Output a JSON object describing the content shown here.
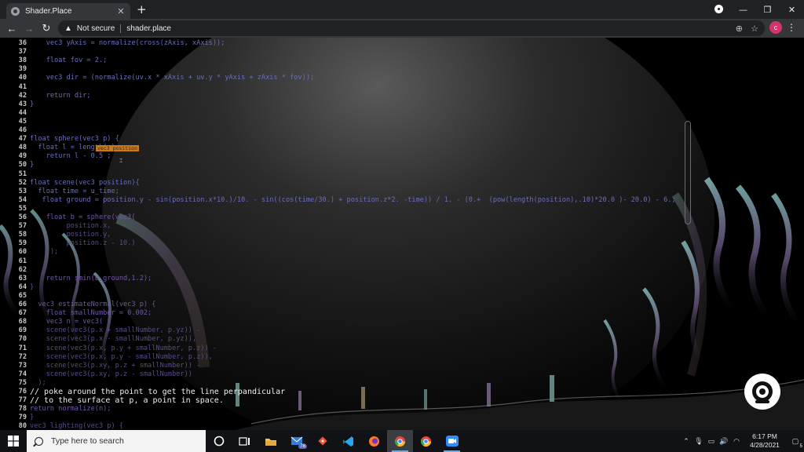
{
  "browser": {
    "tab_title": "Shader.Place",
    "tab_close": "✕",
    "new_tab": "+",
    "security_text": "Not secure",
    "url": "shader.place",
    "profile_initial": "c"
  },
  "window_controls": {
    "minimize": "—",
    "restore": "❐",
    "close": "✕"
  },
  "editor": {
    "tooltip": "vec3 position",
    "lines": [
      {
        "n": "36",
        "code": "    vec3 yAxis = normalize(cross(zAxis, xAxis));",
        "style": "normal"
      },
      {
        "n": "37",
        "code": "",
        "style": "normal"
      },
      {
        "n": "38",
        "code": "    float fov = 2.;",
        "style": "normal"
      },
      {
        "n": "39",
        "code": "",
        "style": "normal"
      },
      {
        "n": "40",
        "code": "    vec3 dir = (normalize(uv.x * xAxis + uv.y * yAxis + zAxis * fov));",
        "style": "normal"
      },
      {
        "n": "41",
        "code": "",
        "style": "normal"
      },
      {
        "n": "42",
        "code": "    return dir;",
        "style": "normal"
      },
      {
        "n": "43",
        "code": "}",
        "style": "normal"
      },
      {
        "n": "44",
        "code": "",
        "style": "normal"
      },
      {
        "n": "45",
        "code": "",
        "style": "normal"
      },
      {
        "n": "46",
        "code": "",
        "style": "normal"
      },
      {
        "n": "47",
        "code": "float sphere(vec3 p) {",
        "style": "normal"
      },
      {
        "n": "48",
        "code": "  float l = length(p);",
        "style": "normal"
      },
      {
        "n": "49",
        "code": "    return l - 0.5 ;",
        "style": "normal"
      },
      {
        "n": "50",
        "code": "}",
        "style": "normal"
      },
      {
        "n": "51",
        "code": "",
        "style": "normal"
      },
      {
        "n": "52",
        "code": "float scene(vec3 position){",
        "style": "normal"
      },
      {
        "n": "53",
        "code": "  float time = u_time;",
        "style": "normal"
      },
      {
        "n": "54",
        "code": "   float ground = position.y - sin(position.x*10.)/10. - sin((cos(time/30.) + position.z*2. -time)) / 1. - (0.+  (pow(length(position),.10)*20.0 )- 20.0) - 6.;",
        "style": "normal"
      },
      {
        "n": "55",
        "code": "",
        "style": "normal"
      },
      {
        "n": "56",
        "code": "    float b = sphere(vec3(",
        "style": "dim2"
      },
      {
        "n": "57",
        "code": "         position.x,",
        "style": "dim"
      },
      {
        "n": "58",
        "code": "         position.y,",
        "style": "dim"
      },
      {
        "n": "59",
        "code": "         position.z - 10.)",
        "style": "dim"
      },
      {
        "n": "60",
        "code": "     );",
        "style": "dim"
      },
      {
        "n": "61",
        "code": "",
        "style": "normal"
      },
      {
        "n": "62",
        "code": "",
        "style": "normal"
      },
      {
        "n": "63",
        "code": "    return smin(b,ground,1.2);",
        "style": "dim2"
      },
      {
        "n": "64",
        "code": "}",
        "style": "dim"
      },
      {
        "n": "65",
        "code": "",
        "style": "normal"
      },
      {
        "n": "66",
        "code": "  vec3 estimateNormal(vec3 p) {",
        "style": "dim2"
      },
      {
        "n": "67",
        "code": "    float smallNumber = 0.002;",
        "style": "dim2"
      },
      {
        "n": "68",
        "code": "    vec3 n = vec3(",
        "style": "dim2"
      },
      {
        "n": "69",
        "code": "    scene(vec3(p.x + smallNumber, p.yz)) -",
        "style": "dim"
      },
      {
        "n": "70",
        "code": "    scene(vec3(p.x - smallNumber, p.yz)),",
        "style": "dim"
      },
      {
        "n": "71",
        "code": "    scene(vec3(p.x, p.y + smallNumber, p.z)) -",
        "style": "dim"
      },
      {
        "n": "72",
        "code": "    scene(vec3(p.x, p.y - smallNumber, p.z)),",
        "style": "dim"
      },
      {
        "n": "73",
        "code": "    scene(vec3(p.xy, p.z + smallNumber)) -",
        "style": "dim"
      },
      {
        "n": "74",
        "code": "    scene(vec3(p.xy, p.z - smallNumber))",
        "style": "dim"
      },
      {
        "n": "75",
        "code": "  );",
        "style": "dim"
      },
      {
        "n": "76",
        "code": "// poke around the point to get the line perpandicular",
        "style": "bright"
      },
      {
        "n": "77",
        "code": "// to the surface at p, a point in space.",
        "style": "bright"
      },
      {
        "n": "78",
        "code": "return normalize(n);",
        "style": "dim2"
      },
      {
        "n": "79",
        "code": "}",
        "style": "dim"
      },
      {
        "n": "80",
        "code": "vec3 lighting(vec3 p) {",
        "style": "dim"
      }
    ]
  },
  "taskbar": {
    "search_placeholder": "Type here to search",
    "mail_badge": "78",
    "time": "6:17 PM",
    "date": "4/28/2021",
    "notification_count": "5"
  },
  "colors": {
    "chrome_dark": "#202124",
    "chrome_toolbar": "#35363a",
    "code_purple": "#6a6fb8",
    "tooltip_orange": "#c77a1d",
    "avatar_pink": "#d6336c"
  }
}
